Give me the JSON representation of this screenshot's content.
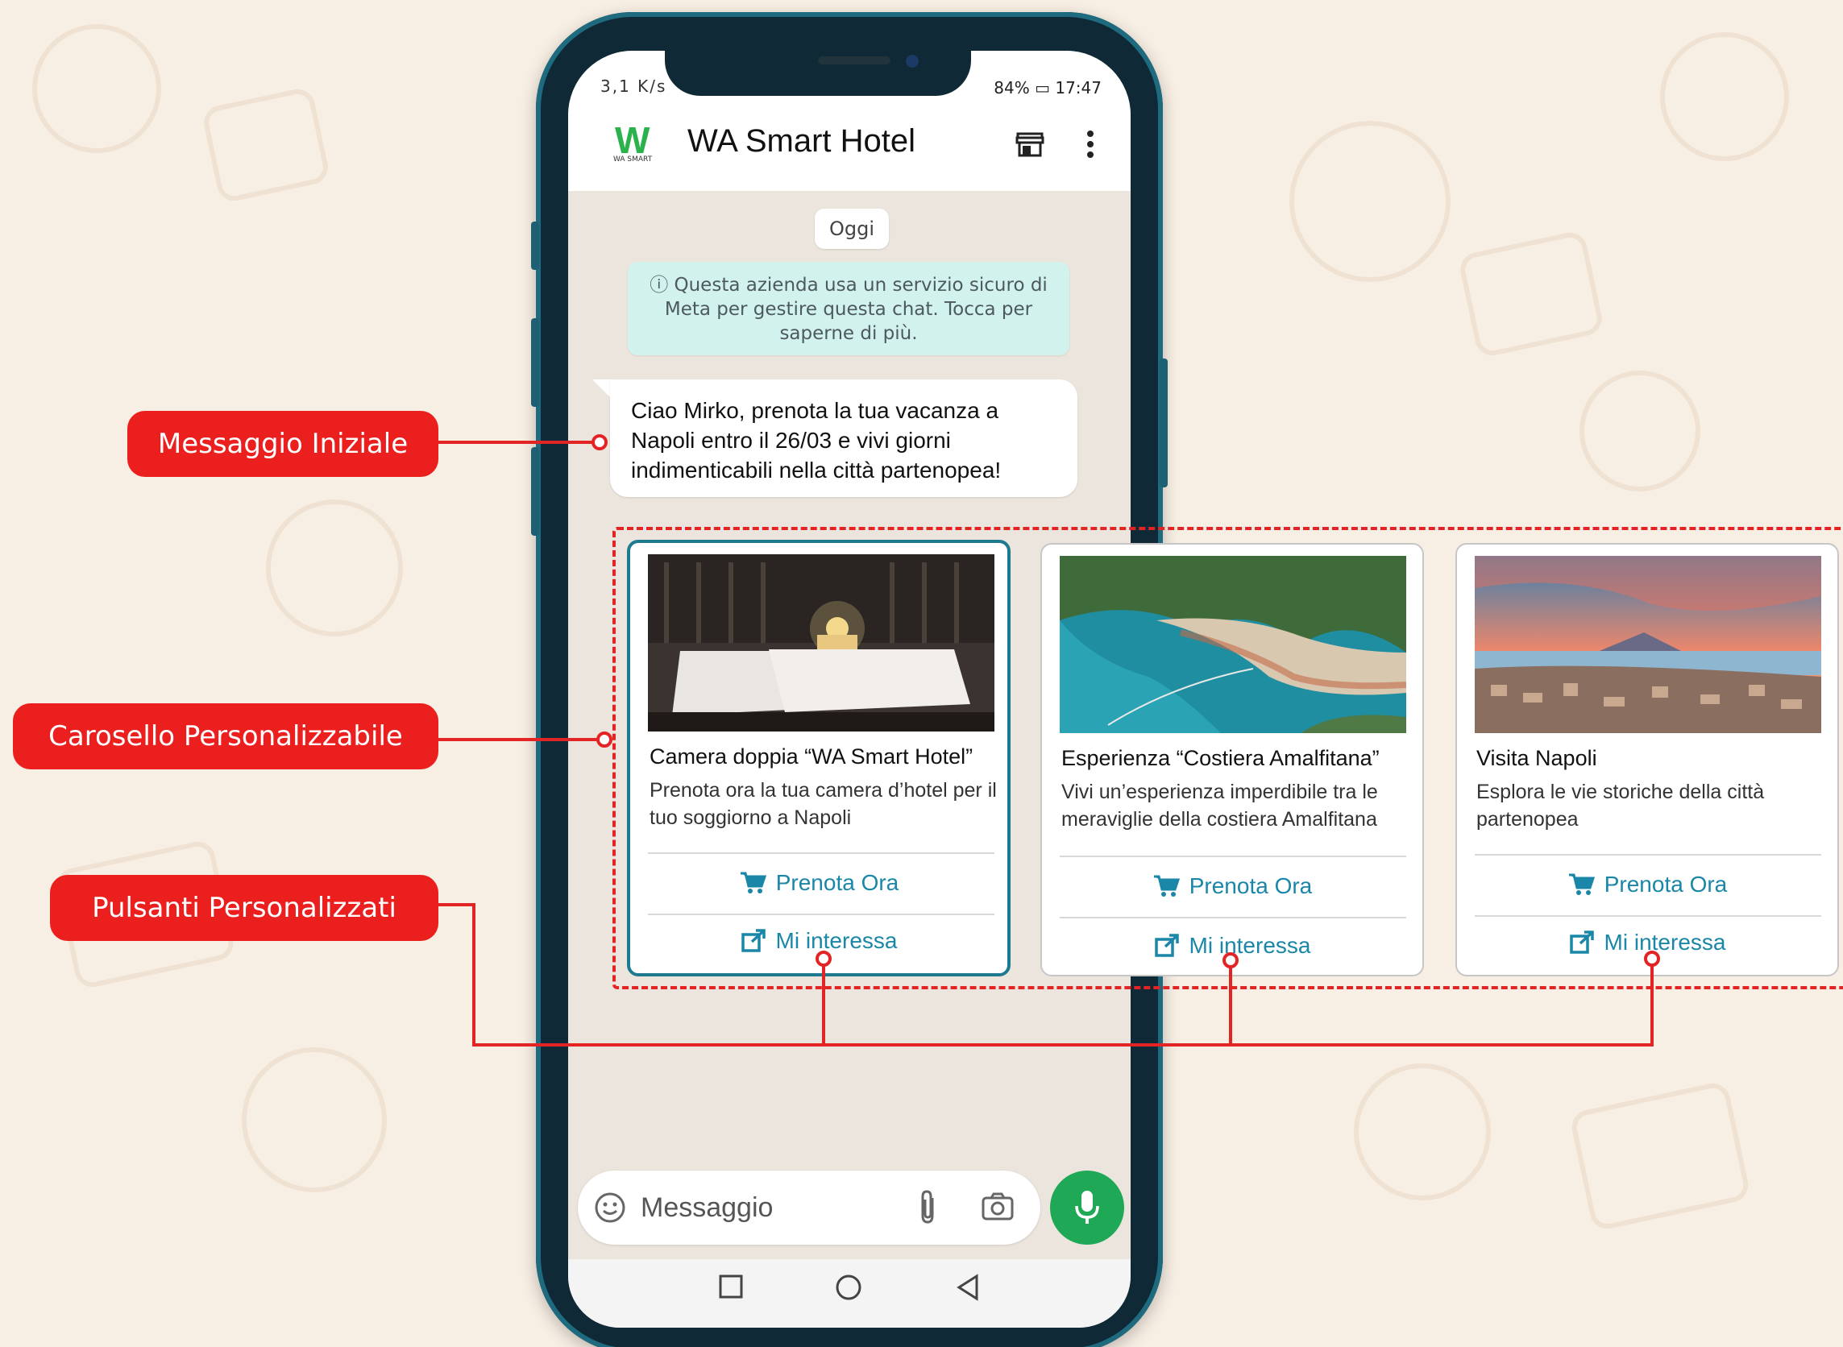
{
  "status": {
    "left": "3,1 K/s",
    "battery": "84%",
    "time": "17:47"
  },
  "header": {
    "logo_text": "WA SMART",
    "title": "WA Smart Hotel"
  },
  "chat": {
    "date_chip": "Oggi",
    "notice": "ⓘ Questa azienda usa un servizio sicuro di Meta per gestire questa chat. Tocca per saperne di più.",
    "message": "Ciao Mirko, prenota la tua vacanza a Napoli entro il 26/03 e vivi giorni indimenticabili nella città partenopea!"
  },
  "carousel": {
    "cards": [
      {
        "title": "Camera doppia “WA Smart Hotel”",
        "description": "Prenota ora la tua camera d’hotel per il tuo soggiorno a Napoli",
        "button_primary": "Prenota Ora",
        "button_secondary": "Mi interessa"
      },
      {
        "title": "Esperienza “Costiera Amalfitana”",
        "description": "Vivi un’esperienza imperdibile tra le meraviglie della costiera Amalfitana",
        "button_primary": "Prenota Ora",
        "button_secondary": "Mi interessa"
      },
      {
        "title": "Visita Napoli",
        "description": "Esplora le vie storiche della città partenopea",
        "button_primary": "Prenota Ora",
        "button_secondary": "Mi interessa"
      }
    ]
  },
  "input": {
    "placeholder": "Messaggio"
  },
  "callouts": {
    "initial_message": "Messaggio Iniziale",
    "carousel": "Carosello Personalizzabile",
    "buttons": "Pulsanti Personalizzati"
  },
  "icons": {
    "store": "store-icon",
    "more": "more-vert-icon",
    "emoji": "emoji-icon",
    "attach": "paperclip-icon",
    "camera": "camera-icon",
    "mic": "mic-icon",
    "cart": "cart-icon",
    "share": "share-icon"
  },
  "colors": {
    "accent": "#1e7a8e",
    "whatsapp_green": "#1fa855",
    "callout_red": "#ec1f1f",
    "button_text": "#1a86a8"
  }
}
